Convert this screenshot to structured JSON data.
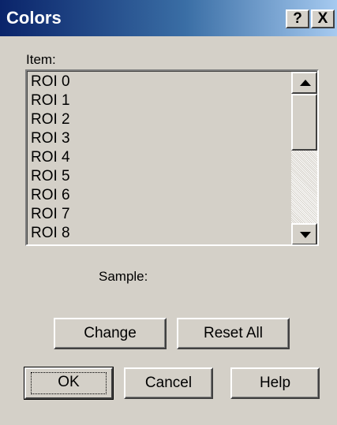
{
  "window": {
    "title": "Colors",
    "help_label": "?",
    "close_label": "X",
    "background": "#d4d0c8",
    "title_gradient": [
      "#0a246a",
      "#a6caf0"
    ]
  },
  "item_list": {
    "label": "Item:",
    "items": [
      "ROI 0",
      "ROI 1",
      "ROI 2",
      "ROI 3",
      "ROI 4",
      "ROI 5",
      "ROI 6",
      "ROI 7",
      "ROI 8"
    ]
  },
  "sample": {
    "label": "Sample:"
  },
  "buttons": {
    "change": "Change",
    "reset_all": "Reset All",
    "ok": "OK",
    "cancel": "Cancel",
    "help": "Help"
  }
}
